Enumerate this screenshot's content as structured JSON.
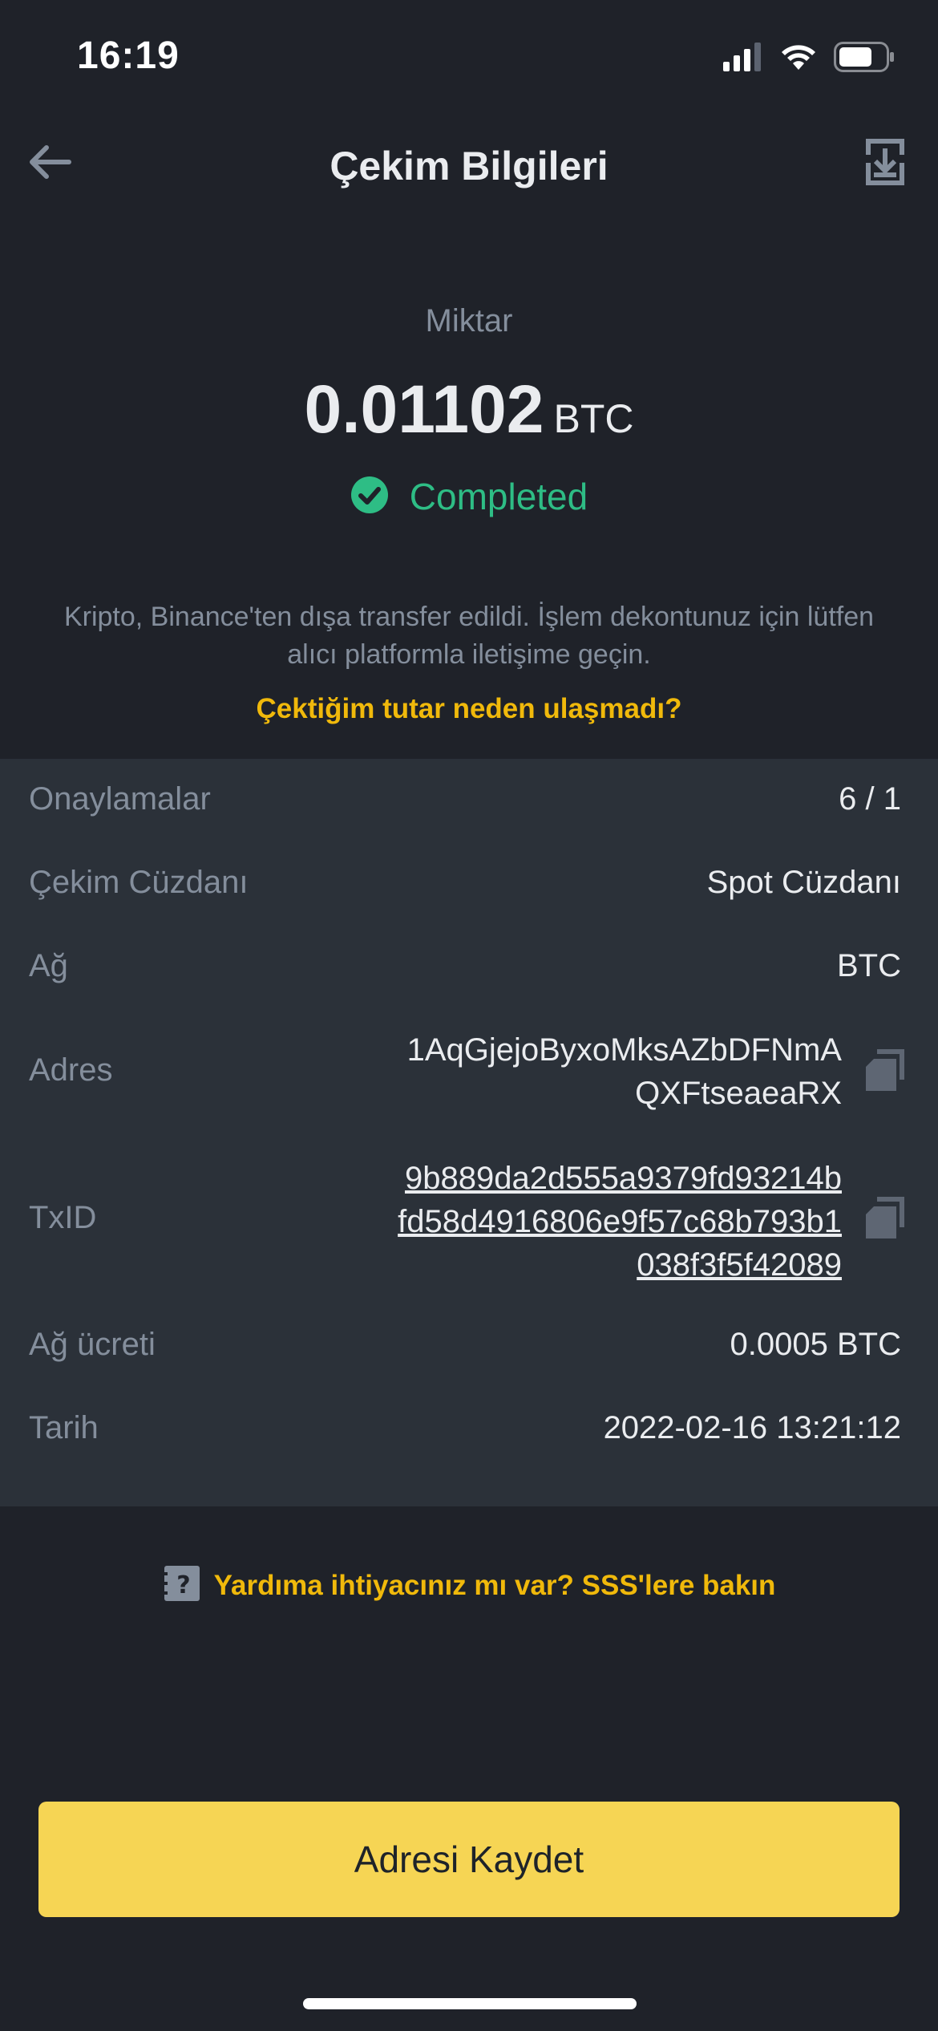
{
  "status_bar": {
    "time": "16:19"
  },
  "header": {
    "title": "Çekim Bilgileri",
    "back_icon": "arrow-left-icon",
    "download_icon": "download-icon"
  },
  "amount": {
    "label": "Miktar",
    "value": "0.01102",
    "unit": "BTC",
    "status": "Completed",
    "status_color": "#2ebd85"
  },
  "info": {
    "message": "Kripto, Binance'ten dışa transfer edildi. İşlem dekontunuz için lütfen alıcı platformla iletişime geçin.",
    "link": "Çektiğim tutar neden ulaşmadı?"
  },
  "details": {
    "confirmations": {
      "label": "Onaylamalar",
      "value": "6 / 1"
    },
    "wallet": {
      "label": "Çekim Cüzdanı",
      "value": "Spot Cüzdanı"
    },
    "network": {
      "label": "Ağ",
      "value": "BTC"
    },
    "address": {
      "label": "Adres",
      "line1": "1AqGjejoByxoMksAZbDFNmA",
      "line2": "QXFtseaeaRX"
    },
    "txid": {
      "label": "TxID",
      "line1": "9b889da2d555a9379fd93214b",
      "line2": "fd58d4916806e9f57c68b793b1",
      "line3": "038f3f5f42089"
    },
    "fee": {
      "label": "Ağ ücreti",
      "value": "0.0005 BTC"
    },
    "date": {
      "label": "Tarih",
      "value": "2022-02-16 13:21:12"
    }
  },
  "help": {
    "text": "Yardıma ihtiyacınız mı var? SSS'lere bakın",
    "icon": "help-document-icon"
  },
  "actions": {
    "save_address": "Adresi Kaydet"
  },
  "colors": {
    "background": "#1f2229",
    "panel": "#2b3139",
    "accent": "#f0b90b",
    "button": "#f6d554",
    "success": "#2ebd85"
  }
}
